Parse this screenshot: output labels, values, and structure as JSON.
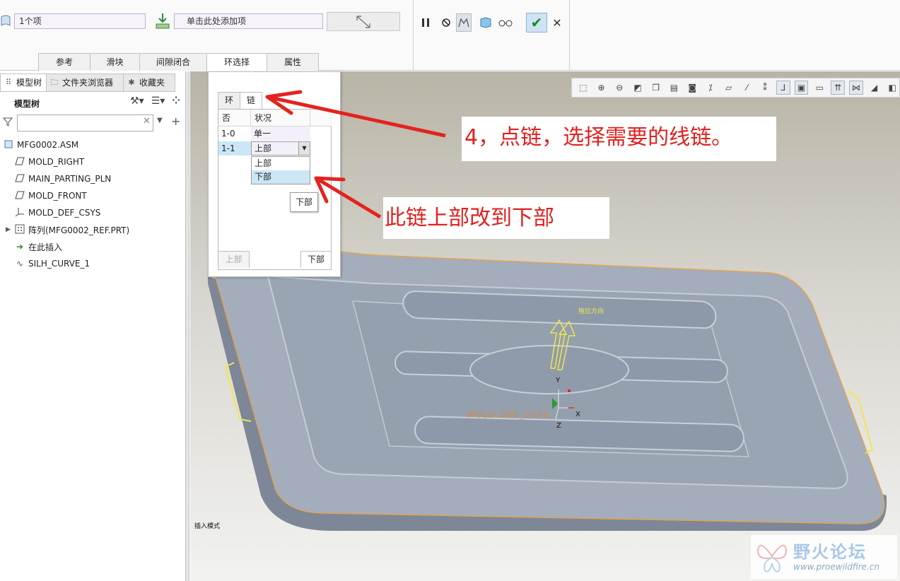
{
  "dashboard": {
    "collector_value": "1个项",
    "add_item_prompt": "单击此处添加项",
    "tabs": [
      {
        "label": "参考"
      },
      {
        "label": "滑块"
      },
      {
        "label": "间隙闭合"
      },
      {
        "label": "环选择"
      },
      {
        "label": "属性"
      }
    ]
  },
  "left_panel": {
    "tabs": [
      {
        "label": "模型树"
      },
      {
        "label": "文件夹浏览器"
      },
      {
        "label": "收藏夹"
      }
    ],
    "heading": "模型树",
    "tree": [
      {
        "label": "MFG0002.ASM",
        "icon": "assembly-icon"
      },
      {
        "label": "MOLD_RIGHT",
        "icon": "datum-plane-icon"
      },
      {
        "label": "MAIN_PARTING_PLN",
        "icon": "datum-plane-icon"
      },
      {
        "label": "MOLD_FRONT",
        "icon": "datum-plane-icon"
      },
      {
        "label": "MOLD_DEF_CSYS",
        "icon": "csys-icon"
      },
      {
        "label": "阵列(MFG0002_REF.PRT)",
        "icon": "pattern-icon"
      },
      {
        "label": "在此插入",
        "icon": "insert-arrow-icon"
      },
      {
        "label": "SILH_CURVE_1",
        "icon": "curve-icon"
      }
    ]
  },
  "loop_panel": {
    "tabs": [
      {
        "label": "环"
      },
      {
        "label": "链"
      }
    ],
    "columns": [
      "否",
      "状况"
    ],
    "rows": [
      {
        "id": "1-0",
        "status": "单一"
      },
      {
        "id": "1-1",
        "status": "上部"
      }
    ],
    "dropdown_options": [
      "上部",
      "下部"
    ],
    "tooltip": "下部",
    "buttons": {
      "upper": "上部",
      "lower": "下部"
    }
  },
  "annotations": {
    "step_text": "4，点链，选择需要的线链。",
    "change_text": "此链上部改到下部"
  },
  "viewport": {
    "pull_direction_label": "拖拉方向",
    "csys_label": "MOLD_DEF_CSYS",
    "axis_y": "Y",
    "axis_x": "X",
    "axis_z": "Z",
    "mode_label": "插入模式"
  },
  "watermark": {
    "title": "野火论坛",
    "url": "www.proewildfire.cn"
  }
}
